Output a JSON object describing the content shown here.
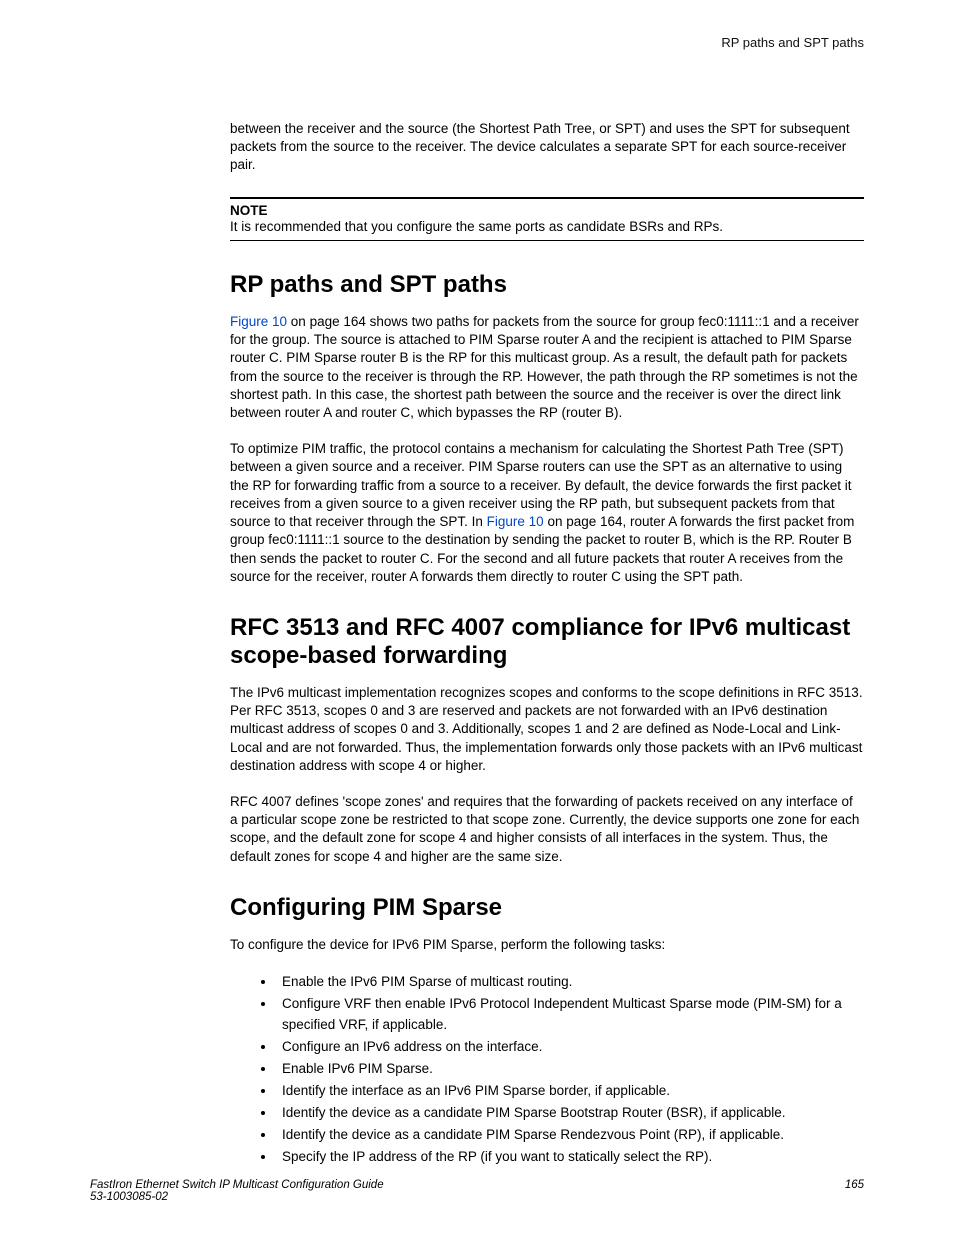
{
  "header": {
    "right": "RP paths and SPT paths"
  },
  "intro_para": "between the receiver and the source (the Shortest Path Tree, or SPT) and uses the SPT for subsequent packets from the source to the receiver. The device calculates a separate SPT for each source-receiver pair.",
  "note": {
    "label": "NOTE",
    "text": "It is recommended that you configure the same ports as candidate BSRs and RPs."
  },
  "sec1": {
    "title": "RP paths and SPT paths",
    "p1_link": "Figure 10",
    "p1_after_link": " on page 164 shows two paths for packets from the source for group fec0:1111::1 and a receiver for the group. The source is attached to PIM Sparse router A and the recipient is attached to PIM Sparse router C. PIM Sparse router B is the RP for this multicast group. As a result, the default path for packets from the source to the receiver is through the RP. However, the path through the RP sometimes is not the shortest path. In this case, the shortest path between the source and the receiver is over the direct link between router A and router C, which bypasses the RP (router B).",
    "p2_before_link": "To optimize PIM traffic, the protocol contains a mechanism for calculating the Shortest Path Tree (SPT) between a given source and a receiver. PIM Sparse routers can use the SPT as an alternative to using the RP for forwarding traffic from a source to a receiver. By default, the device forwards the first packet it receives from a given source to a given receiver using the RP path, but subsequent packets from that source to that receiver through the SPT. In ",
    "p2_link": "Figure 10",
    "p2_after_link": " on page 164, router A forwards the first packet from group fec0:1111::1 source to the destination by sending the packet to router B, which is the RP. Router B then sends the packet to router C. For the second and all future packets that router A receives from the source for the receiver, router A forwards them directly to router C using the SPT path."
  },
  "sec2": {
    "title": "RFC 3513 and RFC 4007 compliance for IPv6 multicast scope-based forwarding",
    "p1": "The IPv6 multicast implementation recognizes scopes and conforms to the scope definitions in RFC 3513. Per RFC 3513, scopes 0 and 3 are reserved and packets are not forwarded with an IPv6 destination multicast address of scopes 0 and 3. Additionally, scopes 1 and 2 are defined as Node-Local and Link-Local and are not forwarded. Thus, the implementation forwards only those packets with an IPv6 multicast destination address with scope 4 or higher.",
    "p2": "RFC 4007 defines 'scope zones' and requires that the forwarding of packets received on any interface of a particular scope zone be restricted to that scope zone. Currently, the device supports one zone for each scope, and the default zone for scope 4 and higher consists of all interfaces in the system. Thus, the default zones for scope 4 and higher are the same size."
  },
  "sec3": {
    "title": "Configuring PIM Sparse",
    "p1": "To configure the device for IPv6 PIM Sparse, perform the following tasks:",
    "items": [
      "Enable the IPv6 PIM Sparse of multicast routing.",
      "Configure VRF then enable IPv6 Protocol Independent Multicast Sparse mode (PIM-SM) for a specified VRF, if applicable.",
      "Configure an IPv6 address on the interface.",
      "Enable IPv6 PIM Sparse.",
      "Identify the interface as an IPv6 PIM Sparse border, if applicable.",
      "Identify the device as a candidate PIM Sparse Bootstrap Router (BSR), if applicable.",
      "Identify the device as a candidate PIM Sparse Rendezvous Point (RP), if applicable.",
      "Specify the IP address of the RP (if you want to statically select the RP)."
    ]
  },
  "footer": {
    "title": "FastIron Ethernet Switch IP Multicast Configuration Guide",
    "docnum": "53-1003085-02",
    "page": "165"
  }
}
